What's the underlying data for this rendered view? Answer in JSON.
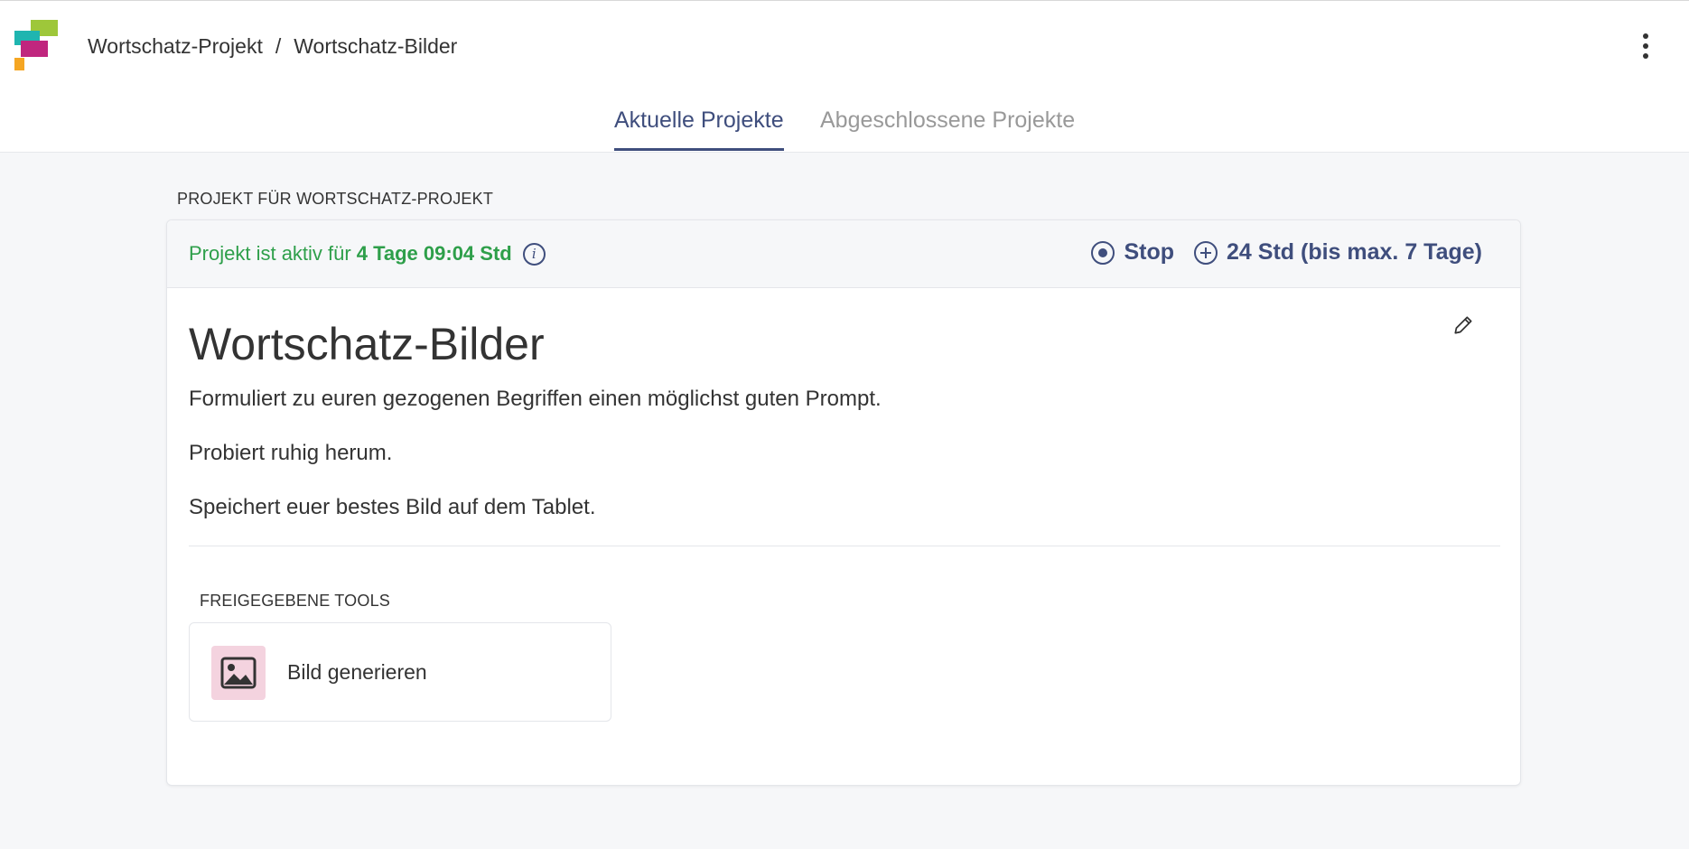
{
  "header": {
    "breadcrumb": [
      "Wortschatz-Projekt",
      "Wortschatz-Bilder"
    ],
    "separator": "/"
  },
  "tabs": [
    {
      "label": "Aktuelle Projekte",
      "active": true
    },
    {
      "label": "Abgeschlossene Projekte",
      "active": false
    }
  ],
  "section_label": "PROJEKT FÜR WORTSCHATZ-PROJEKT",
  "card": {
    "status_prefix": "Projekt ist aktiv für",
    "status_duration": "4 Tage 09:04 Std",
    "stop_label": "Stop",
    "extend_label": "24 Std (bis max. 7 Tage)",
    "title": "Wortschatz-Bilder",
    "paragraphs": [
      "Formuliert zu euren gezogenen Begriffen einen möglichst guten Prompt.",
      "Probiert ruhig herum.",
      "Speichert euer bestes Bild auf dem Tablet."
    ],
    "tools_label": "FREIGEGEBENE TOOLS",
    "tools": [
      {
        "name": "Bild generieren",
        "icon": "image-icon"
      }
    ]
  },
  "colors": {
    "accent": "#3f4e7d",
    "status_green": "#2e9f4a",
    "tool_icon_bg": "#f4d3df",
    "background": "#f6f7f9"
  }
}
